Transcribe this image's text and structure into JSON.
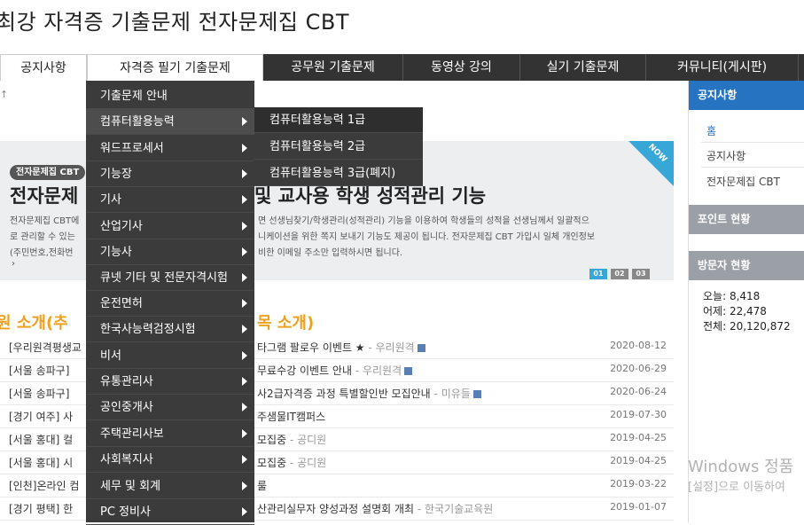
{
  "site_title": "최강 자격증 기출문제 전자문제집 CBT",
  "nav": [
    "공지사항",
    "자격증 필기 기출문제",
    "공무원 기출문제",
    "동영상 강의",
    "실기 기출문제",
    "커뮤니티(게시판)"
  ],
  "breadcrumb_arrow": "↑",
  "right_sidebar": {
    "notice_header": "공지사항",
    "links": [
      "홈",
      "공지사항",
      "전자문제집 CBT"
    ],
    "points_header": "포인트 현황",
    "visitors_header": "방문자 현황",
    "visitors": [
      "오늘: 8,418",
      "어제: 22,478",
      "전체: 20,120,872"
    ]
  },
  "banner": {
    "badge": "전자문제집 CBT",
    "title_left": "전자문제",
    "title_right": "및 교사용 학생 성적관리 기능",
    "text_left": [
      "전자문제집 CBT에",
      "로 관리할 수 있는",
      "(주민번호,전화번",
      "›"
    ],
    "text_right": [
      "면 선생님찾기/학생관리(성적관리) 기능을 이용하여 학생들의 성적을 선생님께서 일괄적으",
      "니케이션을 위한 쪽지 보내기 기능도 제공이 됩니다. 전자문제집 CBT 가입시 일체 개인정보",
      "비한 이메일 주소만 입력하시면 됩니다."
    ],
    "corner": "NOW",
    "pagers": [
      "01",
      "02",
      "03"
    ]
  },
  "section": {
    "title_left": "원 소개(추",
    "title_right": "목 소개)"
  },
  "posts": [
    {
      "left": "[우리원격평생교",
      "right": "타그램 팔로우 이벤트 ★",
      "author": " - 우리원격",
      "date": "2020-08-12",
      "file": true
    },
    {
      "left": "[서울 송파구]",
      "right": "무료수강 이벤트 안내",
      "author": " - 우리원격",
      "date": "2020-06-29",
      "file": true
    },
    {
      "left": "[서울 송파구]",
      "right": "사2급자격증 과정 특별할인반 모집안내",
      "author": " - 미유들",
      "date": "2020-06-24",
      "file": true
    },
    {
      "left": "[경기 여주] 사",
      "right": "주샘물IT캠퍼스",
      "author": "",
      "date": "2019-07-30",
      "file": false
    },
    {
      "left": "[서울 홍대] 컬",
      "right": "모집중",
      "author": " - 공디원",
      "date": "2019-04-25",
      "file": false
    },
    {
      "left": "[서울 홍대] 시",
      "right": "모집중",
      "author": " - 공디원",
      "date": "2019-04-25",
      "file": false
    },
    {
      "left": "[인천]온라인 컴",
      "right": "룰",
      "author": "",
      "date": "2019-03-22",
      "file": false
    },
    {
      "left": "[경기 평택] 한",
      "right": "산관리실무자 양성과정 설명회 개최",
      "author": " - 한국기술교육원",
      "date": "2019-01-07",
      "file": false
    }
  ],
  "dropdown": [
    "기출문제 안내",
    "컴퓨터활용능력",
    "워드프로세서",
    "기능장",
    "기사",
    "산업기사",
    "기능사",
    "큐넷 기타 및 전문자격시험",
    "운전면허",
    "한국사능력검정시험",
    "비서",
    "유통관리사",
    "공인중개사",
    "주택관리사보",
    "사회복지사",
    "세무 및 회계",
    "PC 정비사"
  ],
  "submenu": [
    "컴퓨터활용능력 1급",
    "컴퓨터활용능력 2급",
    "컴퓨터활용능력 3급(폐지)"
  ],
  "watermark": {
    "line1": "Windows 정품",
    "line2": "[설정]으로 이동하여"
  }
}
